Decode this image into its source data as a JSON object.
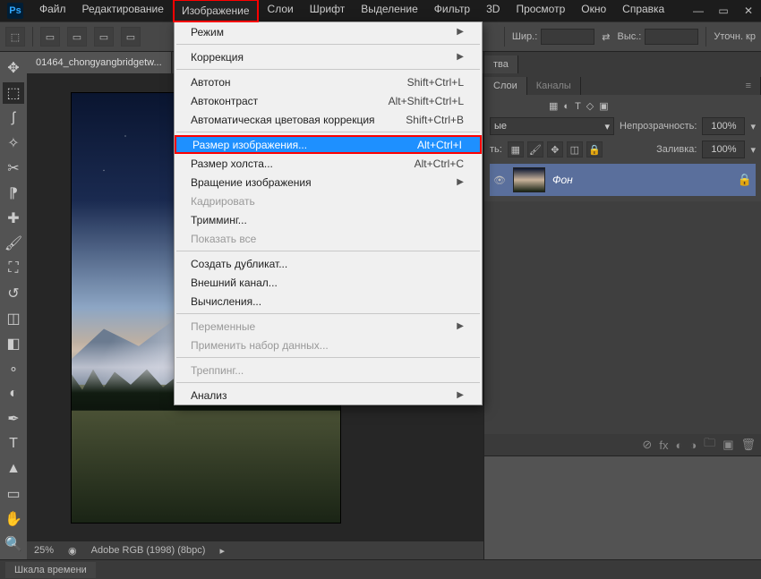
{
  "titlebar": {
    "logo": "Ps",
    "menus": [
      "Файл",
      "Редактирование",
      "Изображение",
      "Слои",
      "Шрифт",
      "Выделение",
      "Фильтр",
      "3D",
      "Просмотр",
      "Окно",
      "Справка"
    ],
    "active_index": 2
  },
  "options_bar": {
    "width_label": "Шир.:",
    "height_label": "Выс.:",
    "refine_label": "Уточн. кр"
  },
  "doc_tab": {
    "title": "01464_chongyangbridgetw..."
  },
  "canvas_status": {
    "zoom": "25%",
    "profile": "Adobe RGB (1998) (8bpc)"
  },
  "dropdown": {
    "items": [
      {
        "label": "Режим",
        "shortcut": "",
        "arrow": true,
        "sep_after": true
      },
      {
        "label": "Коррекция",
        "shortcut": "",
        "arrow": true,
        "sep_after": true
      },
      {
        "label": "Автотон",
        "shortcut": "Shift+Ctrl+L"
      },
      {
        "label": "Автоконтраст",
        "shortcut": "Alt+Shift+Ctrl+L"
      },
      {
        "label": "Автоматическая цветовая коррекция",
        "shortcut": "Shift+Ctrl+B",
        "sep_after": true
      },
      {
        "label": "Размер изображения...",
        "shortcut": "Alt+Ctrl+I",
        "highlight": true,
        "outline": true
      },
      {
        "label": "Размер холста...",
        "shortcut": "Alt+Ctrl+C"
      },
      {
        "label": "Вращение изображения",
        "arrow": true
      },
      {
        "label": "Кадрировать",
        "disabled": true
      },
      {
        "label": "Тримминг..."
      },
      {
        "label": "Показать все",
        "disabled": true,
        "sep_after": true
      },
      {
        "label": "Создать дубликат..."
      },
      {
        "label": "Внешний канал..."
      },
      {
        "label": "Вычисления...",
        "sep_after": true
      },
      {
        "label": "Переменные",
        "arrow": true,
        "disabled": true
      },
      {
        "label": "Применить набор данных...",
        "disabled": true,
        "sep_after": true
      },
      {
        "label": "Треппинг...",
        "disabled": true,
        "sep_after": true
      },
      {
        "label": "Анализ",
        "arrow": true
      }
    ]
  },
  "right_panels": {
    "top_tab": "тва",
    "layers_tab": "Слои",
    "channels_tab": "Каналы",
    "blend_mode": "ые",
    "opacity_label": "Непрозрачность:",
    "opacity_value": "100%",
    "fill_label": "Заливка:",
    "fill_value": "100%",
    "lock_label": "ть:",
    "layer_name": "Фон"
  },
  "bottom_tab": "Шкала времени"
}
